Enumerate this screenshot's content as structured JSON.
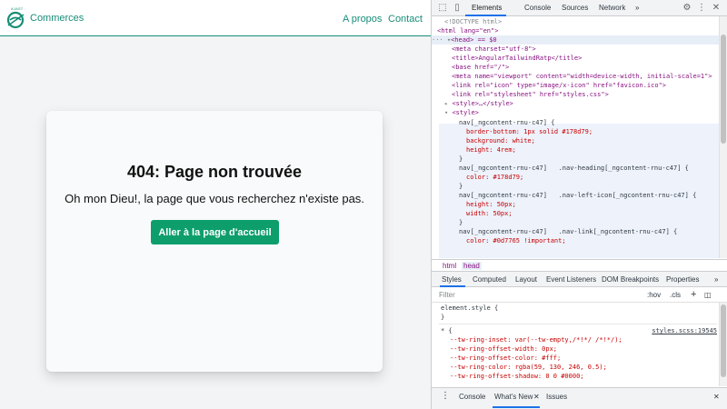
{
  "app": {
    "logo_tag": "AJAST",
    "brand": "Commerces",
    "nav_links": [
      "A propos",
      "Contact"
    ],
    "error_title": "404: Page non trouvée",
    "error_message": "Oh mon Dieu!, la page que vous recherchez n'existe pas.",
    "home_button": "Aller à la page d'accueil",
    "accent_color": "#178d79",
    "button_color": "#0d9e6c"
  },
  "devtools": {
    "tabs": [
      "Elements",
      "Console",
      "Sources",
      "Network"
    ],
    "active_tab": "Elements",
    "more_tabs": "»",
    "icons": [
      "inspect-icon",
      "device-toggle-icon",
      "gear-icon",
      "kebab-menu-icon",
      "close-icon"
    ],
    "dom_lines": [
      "<!DOCTYPE html>",
      "<html lang=\"en\">",
      "<head> == $0",
      "<meta charset=\"utf-8\">",
      "<title>AngularTailwindRatp</title>",
      "<base href=\"/\">",
      "<meta name=\"viewport\" content=\"width=device-width, initial-scale=1\">",
      "<link rel=\"icon\" type=\"image/x-icon\" href=\"favicon.ico\">",
      "<link rel=\"stylesheet\" href=\"styles.css\">",
      "<style>…</style>",
      "<style>",
      "nav[_ngcontent-rnu-c47] {",
      "border-bottom: 1px solid #178d79;",
      "background: white;",
      "height: 4rem;",
      "}",
      "nav[_ngcontent-rnu-c47]   .nav-heading[_ngcontent-rnu-c47] {",
      "color: #178d79;",
      "}",
      "nav[_ngcontent-rnu-c47]   .nav-left-icon[_ngcontent-rnu-c47] {",
      "height: 50px;",
      "width: 50px;",
      "}",
      "nav[_ngcontent-rnu-c47]   .nav-link[_ngcontent-rnu-c47] {",
      "color: #0d7765 !important;"
    ],
    "breadcrumbs": [
      "html",
      "head"
    ],
    "sub_tabs": [
      "Styles",
      "Computed",
      "Layout",
      "Event Listeners",
      "DOM Breakpoints",
      "Properties"
    ],
    "active_sub_tab": "Styles",
    "filter_placeholder": "Filter",
    "filter_buttons": [
      ":hov",
      ".cls",
      "+"
    ],
    "styles_lines": [
      "element.style {",
      "}",
      "* {",
      "--tw-ring-inset: var(--tw-empty,/*!*/ /*!*/);",
      "--tw-ring-offset-width: 0px;",
      "--tw-ring-offset-color: #fff;",
      "--tw-ring-color: rgba(59, 130, 246, 0.5);",
      "--tw-ring-offset-shadow: 0 0 #0000;"
    ],
    "styles_source": "styles.scss:19545",
    "drawer_tabs": [
      "Console",
      "What's New",
      "Issues"
    ],
    "active_drawer_tab": "What's New"
  }
}
